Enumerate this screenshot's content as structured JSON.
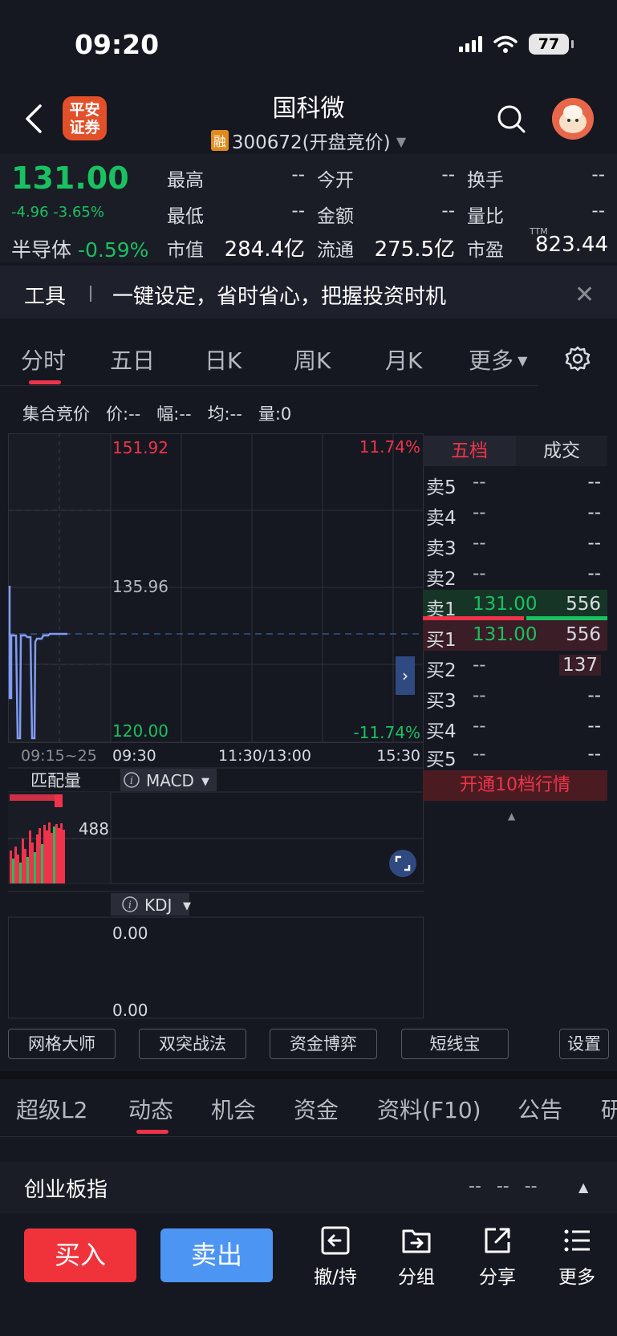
{
  "status_bar": {
    "time": "09:20",
    "battery": "77"
  },
  "header": {
    "broker_logo": "平安\n证券",
    "broker_logo_line1": "平安",
    "broker_logo_line2": "证券",
    "stock_name": "国科微",
    "margin_tag": "融",
    "stock_code": "300672(开盘竞价)"
  },
  "quote": {
    "last_price": "131.00",
    "change": "-4.96 -3.65%",
    "sector_name": "半导体",
    "sector_change": "-0.59%",
    "fields": [
      {
        "label": "最高",
        "value": "--"
      },
      {
        "label": "今开",
        "value": "--"
      },
      {
        "label": "换手",
        "value": "--"
      },
      {
        "label": "最低",
        "value": "--"
      },
      {
        "label": "金额",
        "value": "--"
      },
      {
        "label": "量比",
        "value": "--"
      },
      {
        "label": "市值",
        "value": "284.4亿"
      },
      {
        "label": "流通",
        "value": "275.5亿"
      },
      {
        "label": "市盈",
        "value": "823.44"
      }
    ],
    "pe_suffix": "TTM"
  },
  "tools_banner": {
    "label": "工具",
    "text": "一键设定，省时省心，把握投资时机",
    "close": "✕"
  },
  "period_tabs": [
    "分时",
    "五日",
    "日K",
    "周K",
    "月K",
    "更多"
  ],
  "chart_info": {
    "mode": "集合竞价",
    "price": "价:--",
    "range": "幅:--",
    "avg": "均:--",
    "volume": "量:0"
  },
  "chart": {
    "price_high": "151.92",
    "price_mid": "135.96",
    "price_low": "120.00",
    "pct_high": "11.74%",
    "pct_low": "-11.74%",
    "time_auction": "09:15~25",
    "time_open": "09:30",
    "time_noon": "11:30/13:00",
    "time_close": "15:30",
    "match_volume_label": "匹配量",
    "match_volume_value": "488",
    "macd_label": "MACD",
    "kdj_label": "KDJ",
    "kdj_top": "0.00",
    "kdj_bottom": "0.00"
  },
  "order_book": {
    "tab_five": "五档",
    "tab_deals": "成交",
    "rows": [
      {
        "label": "卖5",
        "price": "--",
        "volume": "--"
      },
      {
        "label": "卖4",
        "price": "--",
        "volume": "--"
      },
      {
        "label": "卖3",
        "price": "--",
        "volume": "--"
      },
      {
        "label": "卖2",
        "price": "--",
        "volume": "--"
      },
      {
        "label": "卖1",
        "price": "131.00",
        "volume": "556"
      },
      {
        "label": "买1",
        "price": "131.00",
        "volume": "556"
      },
      {
        "label": "买2",
        "price": "--",
        "volume": "137"
      },
      {
        "label": "买3",
        "price": "--",
        "volume": "--"
      },
      {
        "label": "买4",
        "price": "--",
        "volume": "--"
      },
      {
        "label": "买5",
        "price": "--",
        "volume": "--"
      }
    ],
    "open_ten_levels": "开通10档行情"
  },
  "tool_buttons": [
    "网格大师",
    "双突战法",
    "资金博弈",
    "短线宝",
    "设置"
  ],
  "bottom_tabs": [
    "超级L2",
    "动态",
    "机会",
    "资金",
    "资料(F10)",
    "公告",
    "研"
  ],
  "index_strip": {
    "name": "创业板指",
    "values": "-- -- --"
  },
  "action_bar": {
    "buy": "买入",
    "sell": "卖出",
    "items": [
      "撤/持",
      "分组",
      "分享",
      "更多"
    ]
  },
  "colors": {
    "up": "#f0334a",
    "down": "#19c160",
    "background": "#151821",
    "line": "#7f9cf5"
  }
}
